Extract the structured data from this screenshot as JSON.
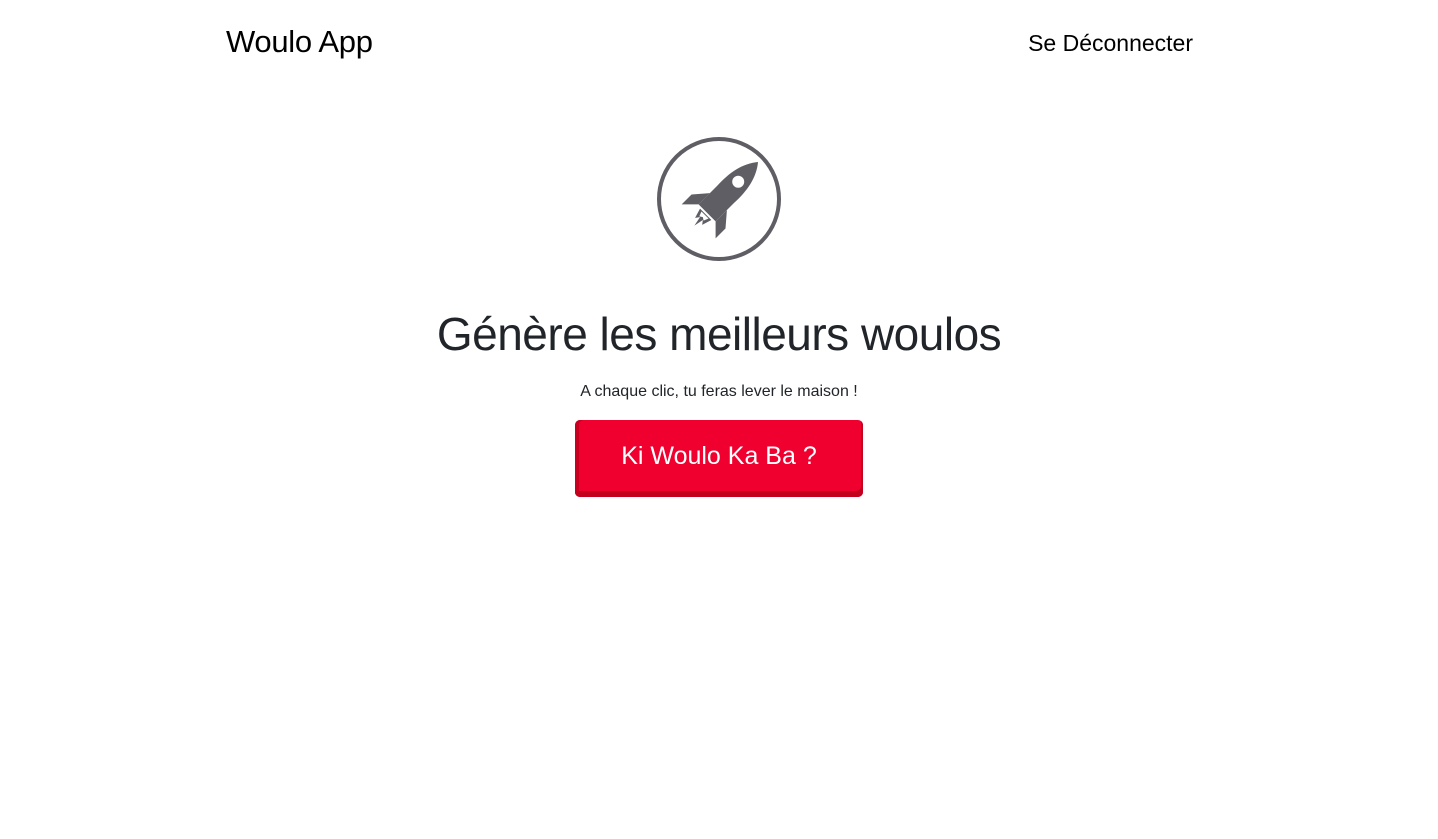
{
  "header": {
    "brand": "Woulo App",
    "logout_label": "Se Déconnecter"
  },
  "hero": {
    "icon": "rocket-icon",
    "title": "Génère les meilleurs woulos",
    "subtitle": "A chaque clic, tu feras lever le maison !",
    "cta_label": "Ki Woulo Ka Ba ?"
  },
  "colors": {
    "accent": "#f0002f",
    "icon_gray": "#5f5e64",
    "text": "#212529"
  }
}
